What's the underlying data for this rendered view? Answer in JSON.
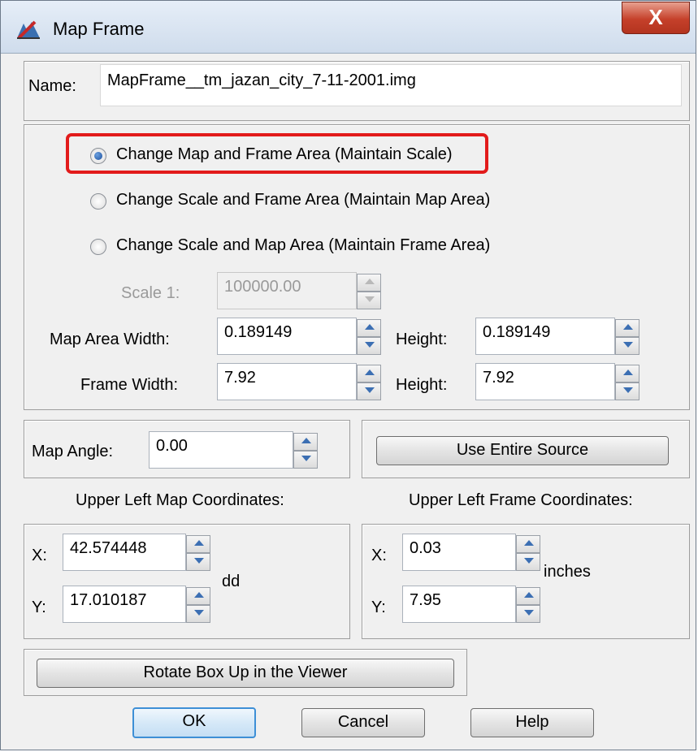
{
  "window": {
    "title": "Map Frame",
    "close_label": "X"
  },
  "name": {
    "label": "Name:",
    "value": "MapFrame__tm_jazan_city_7-11-2001.img"
  },
  "options": [
    {
      "label": "Change Map and Frame Area (Maintain Scale)",
      "selected": true
    },
    {
      "label": "Change Scale and Frame Area (Maintain Map Area)",
      "selected": false
    },
    {
      "label": "Change Scale and Map Area (Maintain Frame Area)",
      "selected": false
    }
  ],
  "scale": {
    "label": "Scale 1:",
    "value": "100000.00",
    "enabled": false
  },
  "map_area": {
    "width_label": "Map Area Width:",
    "width": "0.189149",
    "height_label": "Height:",
    "height": "0.189149"
  },
  "frame": {
    "width_label": "Frame Width:",
    "width": "7.92",
    "height_label": "Height:",
    "height": "7.92"
  },
  "angle": {
    "label": "Map Angle:",
    "value": "0.00"
  },
  "use_entire_source_label": "Use Entire Source",
  "map_coords": {
    "title": "Upper Left Map Coordinates:",
    "x_label": "X:",
    "x": "42.574448",
    "y_label": "Y:",
    "y": "17.010187",
    "unit": "dd"
  },
  "frame_coords": {
    "title": "Upper Left Frame Coordinates:",
    "x_label": "X:",
    "x": "0.03",
    "y_label": "Y:",
    "y": "7.95",
    "unit": "inches"
  },
  "rotate_label": "Rotate Box Up in the Viewer",
  "buttons": {
    "ok": "OK",
    "cancel": "Cancel",
    "help": "Help"
  },
  "colors": {
    "highlight": "#e21b1b",
    "default_button_border": "#3d8fd6",
    "spin_arrow": "#3c6fb3"
  }
}
